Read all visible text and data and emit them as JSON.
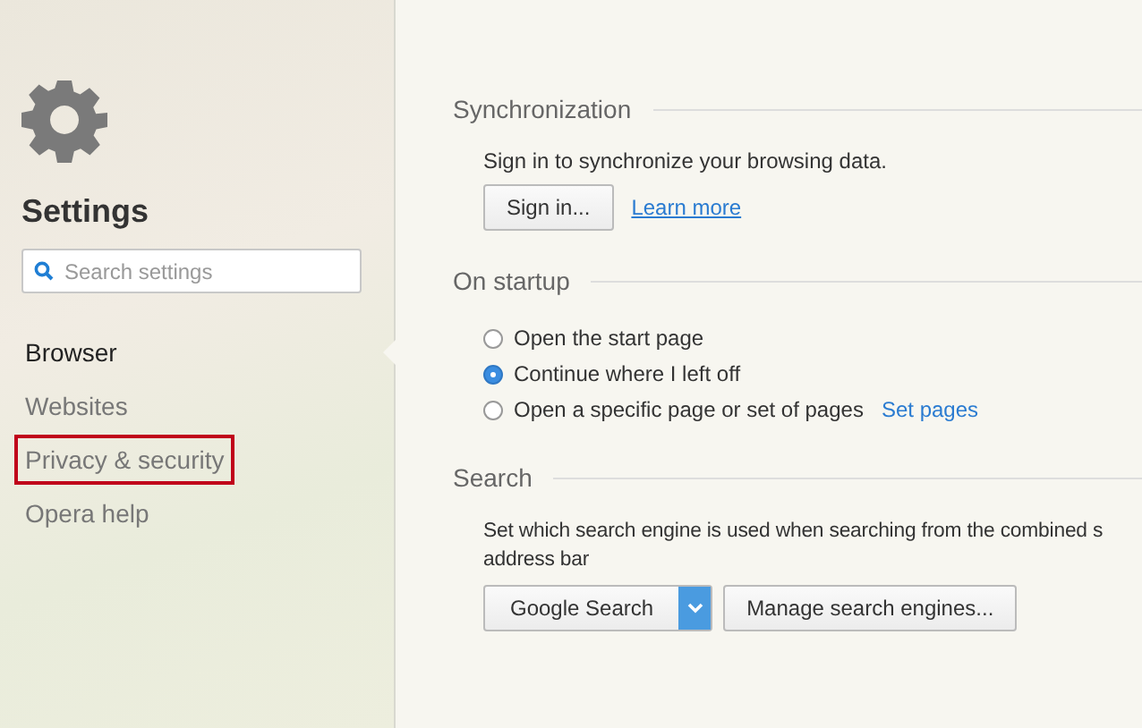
{
  "sidebar": {
    "title": "Settings",
    "search": {
      "placeholder": "Search settings"
    },
    "items": [
      {
        "label": "Browser",
        "selected": true,
        "highlighted": false
      },
      {
        "label": "Websites",
        "selected": false,
        "highlighted": false
      },
      {
        "label": "Privacy & security",
        "selected": false,
        "highlighted": true
      },
      {
        "label": "Opera help",
        "selected": false,
        "highlighted": false
      }
    ]
  },
  "sections": [
    {
      "kind": "sync",
      "title": "Synchronization",
      "text": "Sign in to synchronize your browsing data.",
      "button": "Sign in...",
      "link": "Learn more"
    },
    {
      "kind": "radios",
      "title": "On startup",
      "options": [
        {
          "label": "Open the start page",
          "selected": false
        },
        {
          "label": "Continue where I left off",
          "selected": true
        },
        {
          "label": "Open a specific page or set of pages",
          "selected": false,
          "link": "Set pages"
        }
      ]
    },
    {
      "kind": "search",
      "title": "Search",
      "lines": [
        "Set which search engine is used when searching from the combined s",
        "address bar"
      ],
      "dropdown": "Google Search",
      "button": "Manage search engines..."
    }
  ]
}
